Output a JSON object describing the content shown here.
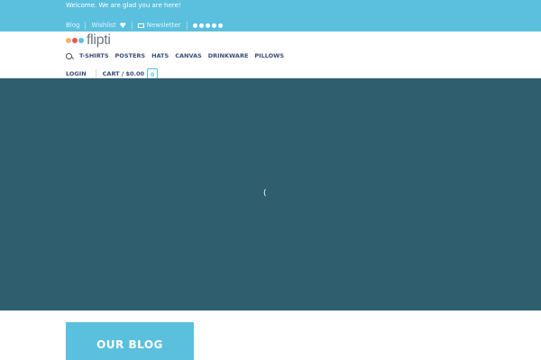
{
  "topbar": {
    "welcome": "Welcome. We are glad you are here!",
    "links": {
      "blog": "Blog",
      "wishlist": "Wishlist",
      "newsletter": "Newsletter"
    },
    "social_icons": [
      "facebook-icon",
      "instagram-icon",
      "twitter-icon",
      "pinterest-icon",
      "youtube-icon"
    ],
    "background": "#5bc0de"
  },
  "header": {
    "logo_text": "flipti",
    "logo_dot_colors": [
      "#f5b36b",
      "#e05a5a",
      "#5bc0de"
    ],
    "nav": [
      "T-SHIRTS",
      "POSTERS",
      "HATS",
      "CANVAS",
      "DRINKWARE",
      "PILLOWS"
    ],
    "login": "LOGIN",
    "cart": {
      "label": "CART /",
      "amount": "$0.00",
      "count": "0"
    },
    "nav_color": "#3d4a7a"
  },
  "hero": {
    "background": "#2f5e6e",
    "loader": "("
  },
  "blog": {
    "title": "OUR BLOG"
  }
}
